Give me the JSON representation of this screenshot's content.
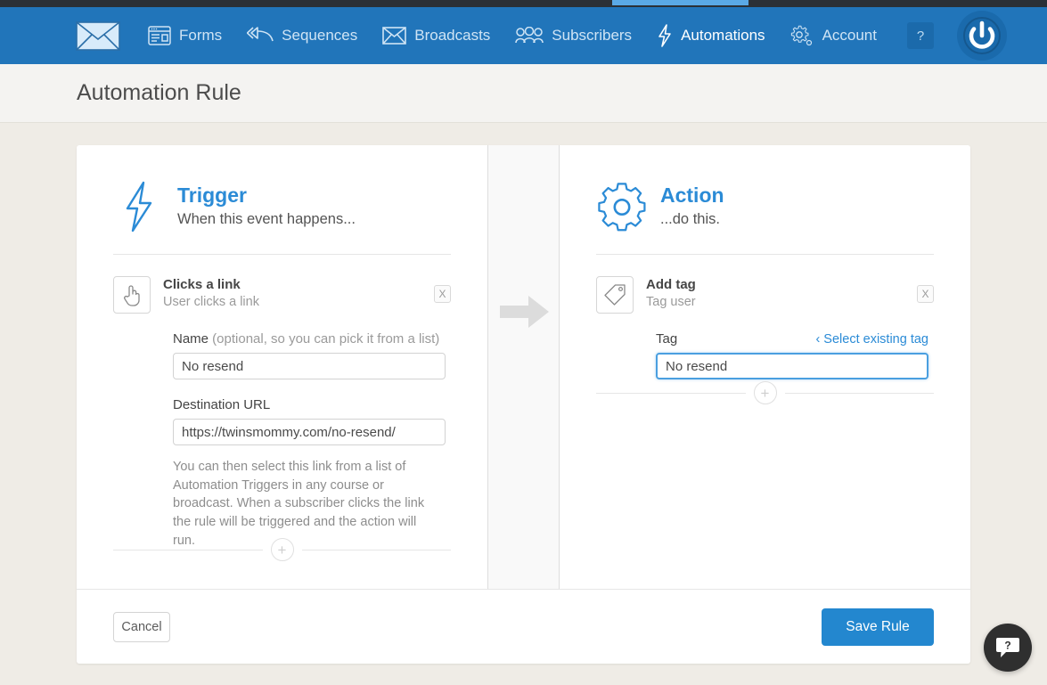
{
  "nav": {
    "logo_icon": "envelope-logo-icon",
    "items": [
      {
        "label": "Forms",
        "icon": "forms-icon",
        "active": false
      },
      {
        "label": "Sequences",
        "icon": "sequences-icon",
        "active": false
      },
      {
        "label": "Broadcasts",
        "icon": "broadcasts-envelope-icon",
        "active": false
      },
      {
        "label": "Subscribers",
        "icon": "subscribers-people-icon",
        "active": false
      },
      {
        "label": "Automations",
        "icon": "automations-bolt-icon",
        "active": true
      },
      {
        "label": "Account",
        "icon": "account-gear-icon",
        "active": false
      }
    ],
    "help_label": "?",
    "avatar_icon": "power-avatar-icon",
    "bar_color": "#2175ba",
    "active_indicator_color": "#5aa9e6"
  },
  "page": {
    "title": "Automation Rule",
    "background": "#efece6"
  },
  "trigger": {
    "icon": "lightning-bolt-icon",
    "title": "Trigger",
    "subtitle": "When this event happens...",
    "step": {
      "icon": "pointing-hand-icon",
      "title": "Clicks a link",
      "description": "User clicks a link",
      "remove_label": "X"
    },
    "name_field": {
      "label": "Name",
      "label_optional": " (optional, so you can pick it from a list)",
      "value": "No resend",
      "placeholder": ""
    },
    "url_field": {
      "label": "Destination URL",
      "value": "https://twinsmommy.com/no-resend/",
      "placeholder": ""
    },
    "help_text": "You can then select this link from a list of Automation Triggers in any course or broadcast. When a subscriber clicks the link the rule will be triggered and the action will run.",
    "add_label": "+"
  },
  "middle": {
    "arrow_icon": "arrow-right-icon"
  },
  "action": {
    "icon": "gear-icon",
    "title": "Action",
    "subtitle": "...do this.",
    "step": {
      "icon": "tag-icon",
      "title": "Add tag",
      "description": "Tag user",
      "remove_label": "X"
    },
    "tag_field": {
      "label": "Tag",
      "select_existing_label": "‹ Select existing tag",
      "value": "No resend",
      "placeholder": "",
      "focused": true
    },
    "add_label": "+"
  },
  "footer": {
    "cancel_label": "Cancel",
    "save_label": "Save Rule",
    "save_color": "#2387cf"
  },
  "chat": {
    "icon": "chat-question-icon"
  }
}
